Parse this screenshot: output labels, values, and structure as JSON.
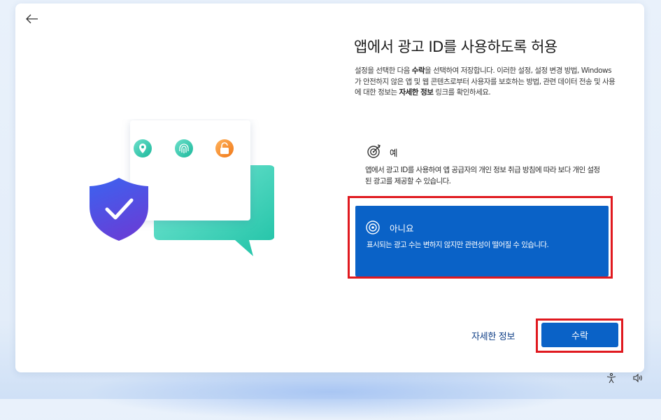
{
  "header": {
    "title": "앱에서 광고 ID를 사용하도록 허용",
    "description_parts": [
      "설정을 선택한 다음 ",
      "수락",
      "을 선택하여 저장합니다. 이러한 설정, 설정 변경 방법, Windows가 안전하지 않은 앱 및 웹 콘텐츠로부터 사용자를 보호하는 방법, 관련 데이터 전송 및 사용에 대한 정보는 ",
      "자세한 정보",
      " 링크를 확인하세요."
    ]
  },
  "options": {
    "yes": {
      "label": "예",
      "description": "앱에서 광고 ID를 사용하여 앱 공급자의 개인 정보 취급 방침에 따라 보다 개인 설정된 광고를 제공할 수 있습니다.",
      "selected": false
    },
    "no": {
      "label": "아니요",
      "description": "표시되는 광고 수는 변하지 않지만 관련성이 떨어질 수 있습니다.",
      "selected": true
    }
  },
  "footer": {
    "more_info_label": "자세한 정보",
    "accept_label": "수락"
  },
  "icons": {
    "back": "arrow-left-icon",
    "yes": "target-icon",
    "no": "radio-selected-icon",
    "illustration": [
      "location-icon",
      "fingerprint-icon",
      "lock-icon",
      "shield-check-icon"
    ],
    "tray": [
      "accessibility-icon",
      "volume-icon"
    ]
  },
  "colors": {
    "accent": "#0a62c7",
    "highlight": "#e0191f",
    "shield": "#3f53e6",
    "teal": "#2ecab2"
  }
}
